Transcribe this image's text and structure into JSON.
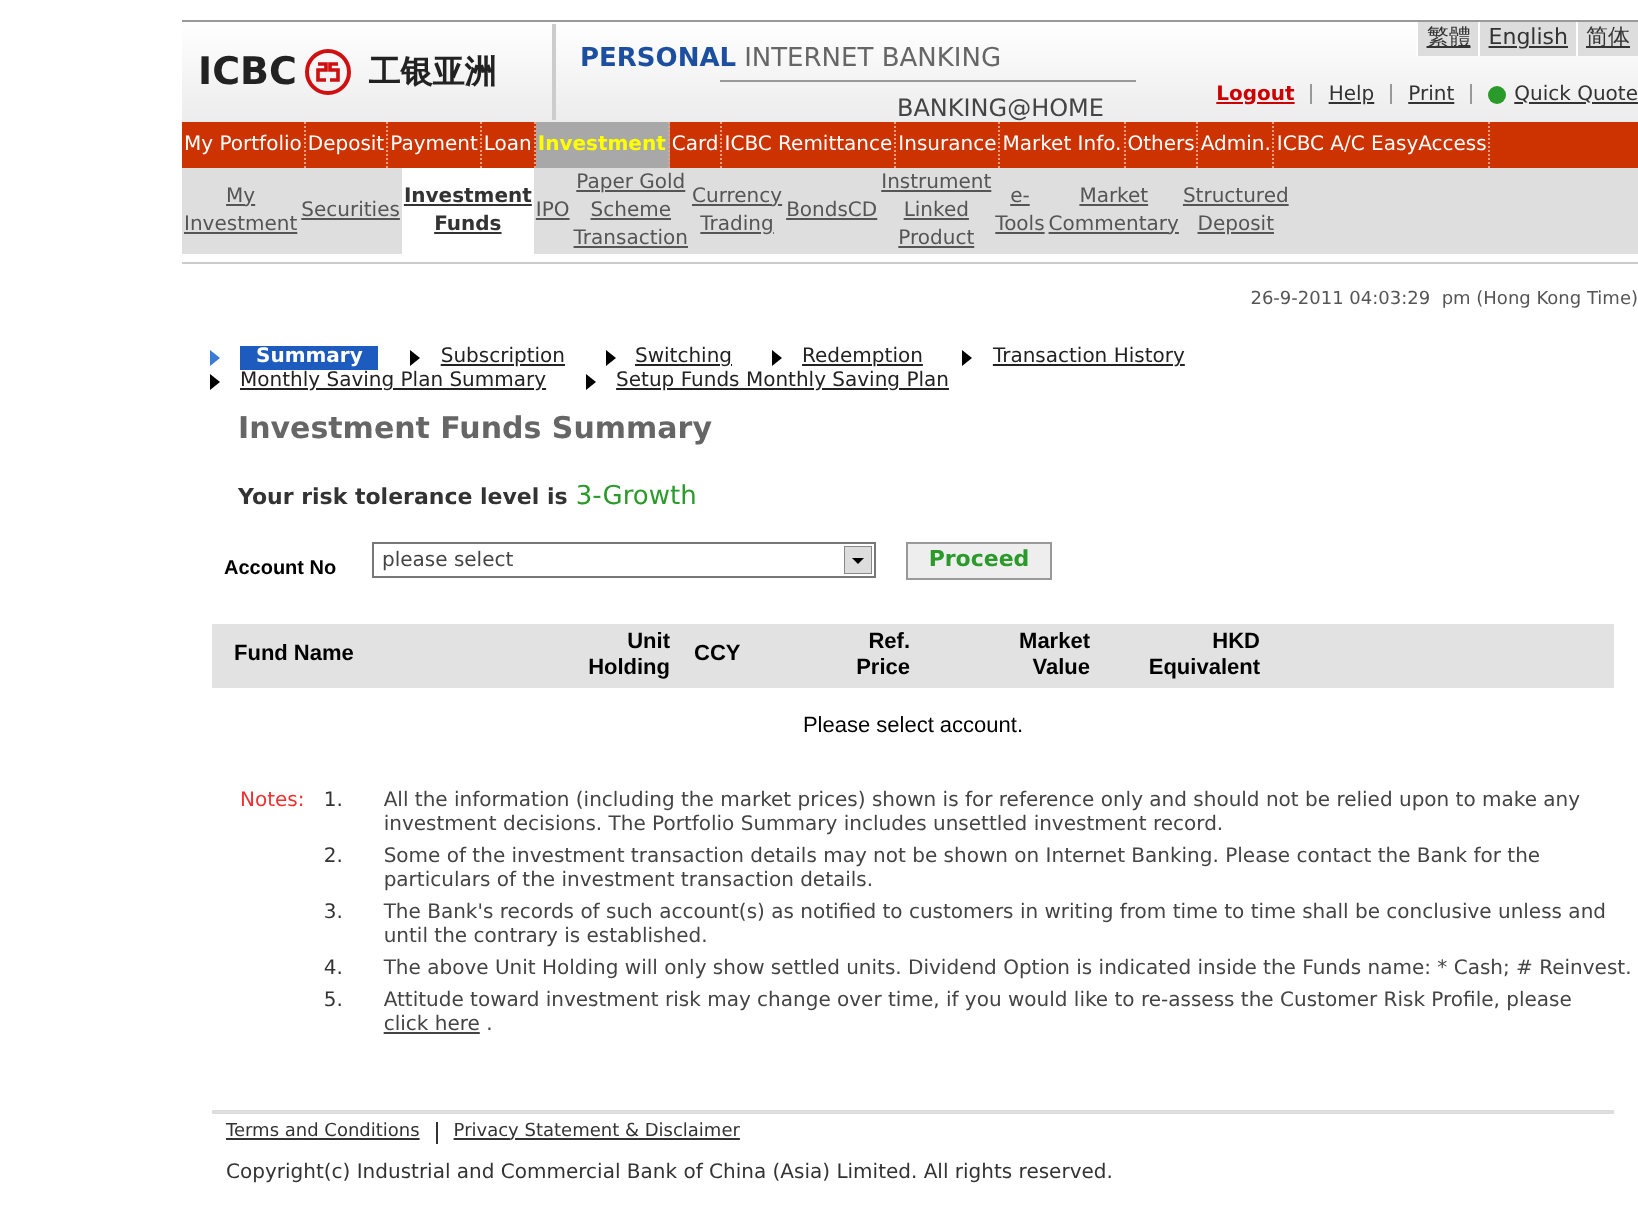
{
  "header": {
    "logo_text": "ICBC",
    "logo_chinese": "工银亚洲",
    "title_bold": "PERSONAL",
    "title_rest": "INTERNET BANKING",
    "subtitle": "BANKING@HOME",
    "languages": [
      "繁體",
      "English",
      "简体"
    ],
    "links": [
      {
        "label": "Logout",
        "kind": "logout"
      },
      {
        "label": "Help",
        "kind": "plain"
      },
      {
        "label": "Print",
        "kind": "plain"
      },
      {
        "label": "Quick Quote",
        "kind": "quote"
      }
    ]
  },
  "main_nav": [
    {
      "label": "My Portfolio",
      "selected": false
    },
    {
      "label": "Deposit",
      "selected": false
    },
    {
      "label": "Payment",
      "selected": false
    },
    {
      "label": "Loan",
      "selected": false
    },
    {
      "label": "Investment",
      "selected": true
    },
    {
      "label": "Card",
      "selected": false
    },
    {
      "label": "ICBC Remittance",
      "selected": false
    },
    {
      "label": "Insurance",
      "selected": false
    },
    {
      "label": "Market Info.",
      "selected": false
    },
    {
      "label": "Others",
      "selected": false
    },
    {
      "label": "Admin.",
      "selected": false
    },
    {
      "label": "ICBC A/C EasyAccess",
      "selected": false
    }
  ],
  "sub_nav": [
    {
      "lines": [
        "My",
        "Investment"
      ],
      "selected": false
    },
    {
      "lines": [
        "Securities"
      ],
      "selected": false
    },
    {
      "lines": [
        "Investment",
        "Funds"
      ],
      "selected": true
    },
    {
      "lines": [
        "IPO"
      ],
      "selected": false
    },
    {
      "lines": [
        "Paper Gold",
        "Scheme",
        "Transaction"
      ],
      "selected": false
    },
    {
      "lines": [
        "Currency",
        "Trading"
      ],
      "selected": false
    },
    {
      "lines": [
        "BondsCD"
      ],
      "selected": false
    },
    {
      "lines": [
        "Instrument",
        "Linked",
        "Product"
      ],
      "selected": false
    },
    {
      "lines": [
        "e-",
        "Tools"
      ],
      "selected": false
    },
    {
      "lines": [
        "Market",
        "Commentary"
      ],
      "selected": false
    },
    {
      "lines": [
        "Structured",
        "Deposit"
      ],
      "selected": false
    }
  ],
  "datetime": "26-9-2011 04:03:29  pm (Hong Kong Time)",
  "tabs": [
    {
      "label": "Summary",
      "selected": true
    },
    {
      "label": "Subscription",
      "selected": false
    },
    {
      "label": "Switching",
      "selected": false
    },
    {
      "label": "Redemption",
      "selected": false
    },
    {
      "label": "Transaction History",
      "selected": false
    },
    {
      "label": "Monthly Saving Plan Summary",
      "selected": false
    },
    {
      "label": "Setup Funds Monthly Saving Plan",
      "selected": false
    }
  ],
  "page_title": "Investment Funds Summary",
  "risk": {
    "label": "Your risk tolerance level is",
    "value": "3-Growth"
  },
  "account": {
    "label": "Account No",
    "value": "please select",
    "button": "Proceed"
  },
  "table": {
    "columns": [
      [
        "Fund Name"
      ],
      [
        "Unit",
        "Holding"
      ],
      [
        "CCY"
      ],
      [
        "Ref.",
        "Price"
      ],
      [
        "Market",
        "Value"
      ],
      [
        "HKD",
        "Equivalent"
      ]
    ],
    "empty_message": "Please select account."
  },
  "notes": {
    "label": "Notes:",
    "items": [
      {
        "number": "1.",
        "text": "All the information (including the market prices) shown is for reference only and should not be relied upon to make any investment decisions. The Portfolio Summary includes unsettled investment record."
      },
      {
        "number": "2.",
        "text": "Some of the investment transaction details may not be shown on Internet Banking. Please contact the Bank for the particulars of the investment transaction details."
      },
      {
        "number": "3.",
        "text": "The Bank's records of such account(s) as notified to customers in writing from time to time shall be conclusive unless and until the contrary is established."
      },
      {
        "number": "4.",
        "text": "The above Unit Holding will only show settled units. Dividend Option is indicated inside the Funds name: * Cash; # Reinvest."
      },
      {
        "number": "5.",
        "text": "Attitude toward investment risk may change over time, if you would like to re-assess the Customer Risk Profile, please",
        "link": "click here",
        "after": "."
      }
    ]
  },
  "footer": {
    "links": [
      "Terms and Conditions",
      "Privacy Statement & Disclaimer"
    ],
    "copyright": "Copyright(c) Industrial and Commercial Bank of China (Asia) Limited. All rights reserved."
  }
}
